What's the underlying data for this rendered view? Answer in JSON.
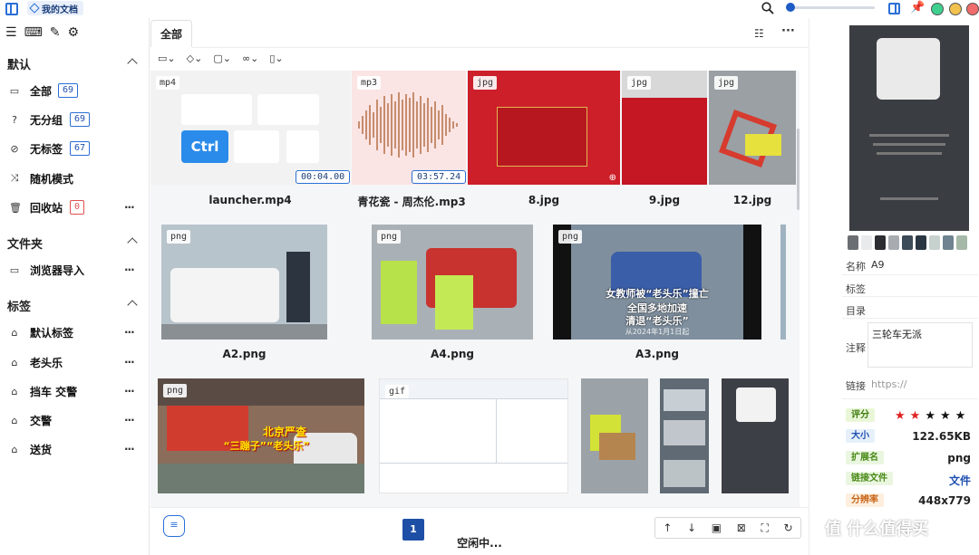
{
  "topbar": {
    "doc_tab": "我的文档",
    "zoom_value": 0.02
  },
  "sidebar": {
    "sections": [
      {
        "title": "默认"
      },
      {
        "title": "文件夹"
      },
      {
        "title": "标签"
      }
    ],
    "default_items": [
      {
        "label": "全部",
        "count": "69",
        "icon": "inbox-icon"
      },
      {
        "label": "无分组",
        "count": "69",
        "icon": "question-icon"
      },
      {
        "label": "无标签",
        "count": "67",
        "icon": "tag-off-icon"
      },
      {
        "label": "随机模式",
        "icon": "shuffle-icon"
      },
      {
        "label": "回收站",
        "count": "0",
        "icon": "trash-icon"
      }
    ],
    "folder_items": [
      {
        "label": "浏览器导入",
        "icon": "folder-icon"
      }
    ],
    "tag_items": [
      {
        "label": "默认标签"
      },
      {
        "label": "老头乐"
      },
      {
        "label": "挡车 交警"
      },
      {
        "label": "交警"
      },
      {
        "label": "送货"
      }
    ],
    "more": "···"
  },
  "main": {
    "tab_all": "全部",
    "more": "···",
    "page": "1",
    "status": "空闲中...",
    "files": [
      {
        "type": "mp4",
        "name": "launcher.mp4",
        "duration": "00:04.00",
        "key_label": "Ctrl"
      },
      {
        "type": "mp3",
        "name": "青花瓷 - 周杰伦.mp3",
        "duration": "03:57.24"
      },
      {
        "type": "jpg",
        "name": "8.jpg"
      },
      {
        "type": "jpg",
        "name": "9.jpg"
      },
      {
        "type": "jpg",
        "name": "12.jpg"
      },
      {
        "type": "png",
        "name": "A2.png"
      },
      {
        "type": "png",
        "name": "A4.png"
      },
      {
        "type": "png",
        "name": "A3.png",
        "overlay1": "女教师被“老头乐”撞亡",
        "overlay2": "全国多地加速",
        "overlay3": "清退“老头乐”",
        "overlay4": "从2024年1月1日起"
      },
      {
        "type": "png",
        "overlay1": "北京严查",
        "overlay2": "“三蹦子”“老头乐”"
      },
      {
        "type": "gif"
      }
    ]
  },
  "right_panel": {
    "name_label": "名称",
    "name_value": "A9",
    "tags_label": "标签",
    "folder_label": "目录",
    "note_label": "注释",
    "note_value": "三轮车无派",
    "link_label": "链接",
    "link_placeholder": "https://",
    "rating_label": "评分",
    "rating_value": 2,
    "rating_max": 5,
    "size_label": "大小",
    "size_value": "122.65KB",
    "ext_label": "扩展名",
    "ext_value": "png",
    "linked_label": "链接文件",
    "linked_value": "文件",
    "res_label": "分辨率",
    "res_value": "448x779",
    "swatch_colors": [
      "#6b6e73",
      "#e9eaeb",
      "#2b2d31",
      "#a8acb0",
      "#3d4a57",
      "#2a3642",
      "#c7d2cf",
      "#6f8390",
      "#a6b9a8"
    ],
    "accent": "#1e5bc6"
  },
  "watermark": "值 什么值得买"
}
